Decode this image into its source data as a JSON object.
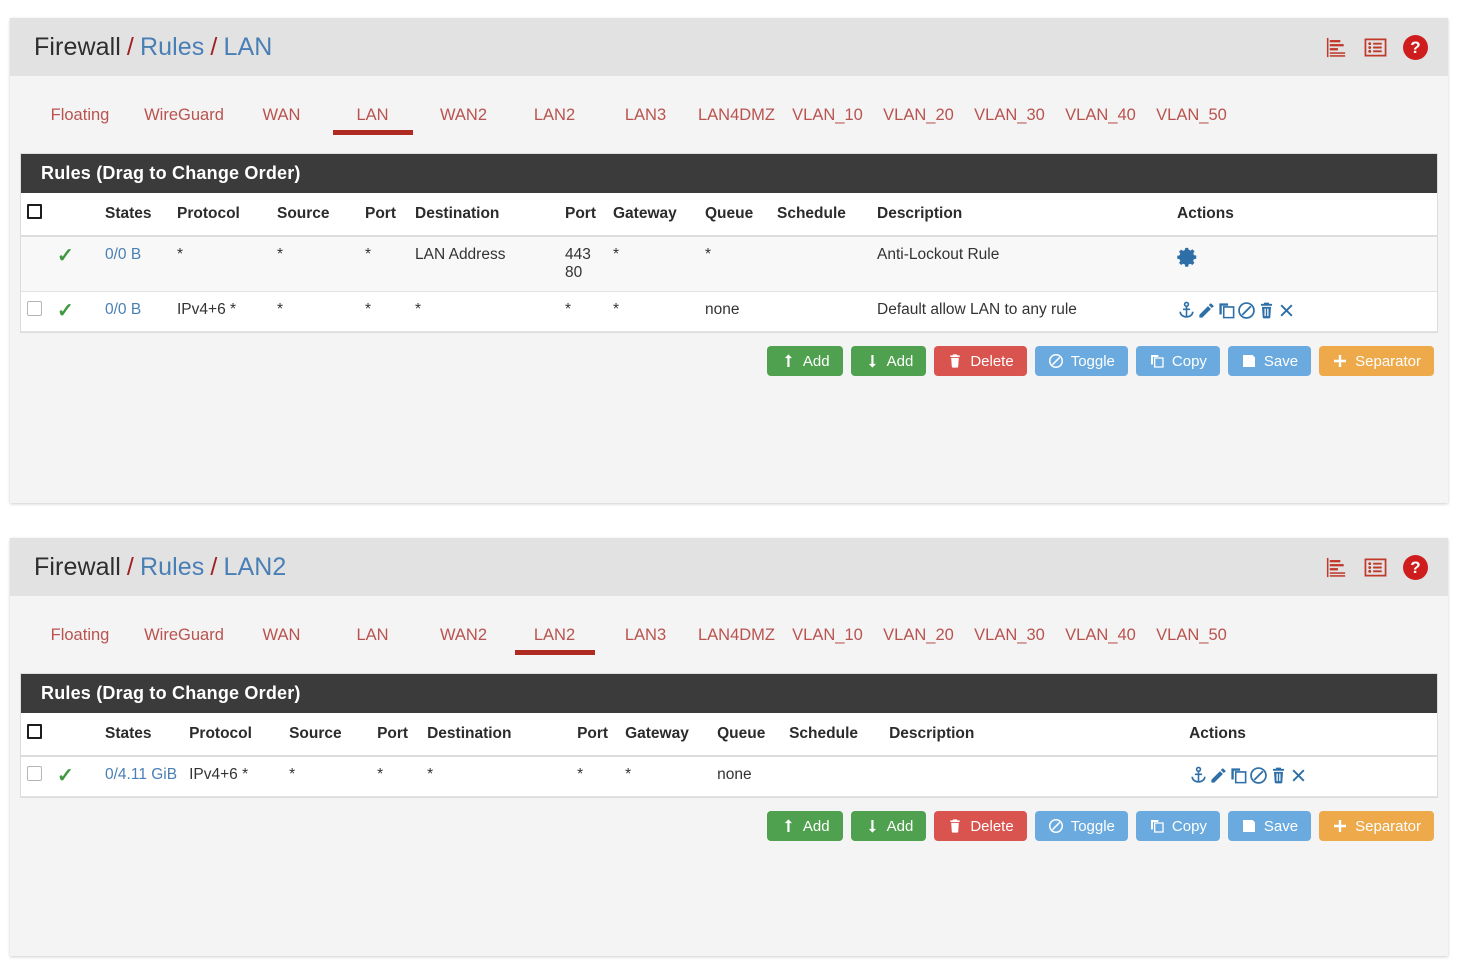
{
  "panels": [
    {
      "breadcrumb": {
        "root": "Firewall",
        "sep": "/",
        "level2": "Rules",
        "level3": "LAN"
      },
      "header_icons": [
        {
          "name": "align-left-chart-icon",
          "label": ""
        },
        {
          "name": "list-icon",
          "label": ""
        },
        {
          "name": "help-icon",
          "label": "?"
        }
      ],
      "tabs": [
        {
          "label": "Floating",
          "active": false
        },
        {
          "label": "WireGuard",
          "active": false
        },
        {
          "label": "WAN",
          "active": false
        },
        {
          "label": "LAN",
          "active": true
        },
        {
          "label": "WAN2",
          "active": false
        },
        {
          "label": "LAN2",
          "active": false
        },
        {
          "label": "LAN3",
          "active": false
        },
        {
          "label": "LAN4DMZ",
          "active": false
        },
        {
          "label": "VLAN_10",
          "active": false
        },
        {
          "label": "VLAN_20",
          "active": false
        },
        {
          "label": "VLAN_30",
          "active": false
        },
        {
          "label": "VLAN_40",
          "active": false
        },
        {
          "label": "VLAN_50",
          "active": false
        }
      ],
      "card_title": "Rules (Drag to Change Order)",
      "columns": [
        "",
        "",
        "States",
        "Protocol",
        "Source",
        "Port",
        "Destination",
        "Port",
        "Gateway",
        "Queue",
        "Schedule",
        "Description",
        "Actions"
      ],
      "rows": [
        {
          "checkbox": false,
          "status": "pass",
          "states": "0/0 B",
          "protocol": "*",
          "source": "*",
          "port": "*",
          "destination": "LAN Address",
          "port2": "443\n80",
          "gateway": "*",
          "queue": "*",
          "schedule": "",
          "description": "Anti-Lockout Rule",
          "actions": [
            "gear-icon"
          ]
        },
        {
          "checkbox": true,
          "status": "pass",
          "states": "0/0 B",
          "protocol": "IPv4+6 *",
          "source": "*",
          "port": "*",
          "destination": "*",
          "port2": "*",
          "gateway": "*",
          "queue": "none",
          "schedule": "",
          "description": "Default allow LAN to any rule",
          "actions": [
            "anchor-icon",
            "edit-pencil-icon",
            "copy-icon",
            "ban-toggle-icon",
            "trash-delete-icon",
            "close-x-icon"
          ]
        }
      ],
      "buttons": [
        {
          "label": "Add",
          "icon": "arrow-up-icon",
          "color": "#4fa14f"
        },
        {
          "label": "Add",
          "icon": "arrow-down-icon",
          "color": "#4fa14f"
        },
        {
          "label": "Delete",
          "icon": "trash-icon",
          "color": "#d9534f"
        },
        {
          "label": "Toggle",
          "icon": "ban-icon",
          "color": "#6aaade"
        },
        {
          "label": "Copy",
          "icon": "copy-icon",
          "color": "#6aaade"
        },
        {
          "label": "Save",
          "icon": "floppy-save-icon",
          "color": "#6aaade"
        },
        {
          "label": "Separator",
          "icon": "plus-icon",
          "color": "#eda94a"
        }
      ]
    },
    {
      "breadcrumb": {
        "root": "Firewall",
        "sep": "/",
        "level2": "Rules",
        "level3": "LAN2"
      },
      "header_icons": [
        {
          "name": "align-left-chart-icon",
          "label": ""
        },
        {
          "name": "list-icon",
          "label": ""
        },
        {
          "name": "help-icon",
          "label": "?"
        }
      ],
      "tabs": [
        {
          "label": "Floating",
          "active": false
        },
        {
          "label": "WireGuard",
          "active": false
        },
        {
          "label": "WAN",
          "active": false
        },
        {
          "label": "LAN",
          "active": false
        },
        {
          "label": "WAN2",
          "active": false
        },
        {
          "label": "LAN2",
          "active": true
        },
        {
          "label": "LAN3",
          "active": false
        },
        {
          "label": "LAN4DMZ",
          "active": false
        },
        {
          "label": "VLAN_10",
          "active": false
        },
        {
          "label": "VLAN_20",
          "active": false
        },
        {
          "label": "VLAN_30",
          "active": false
        },
        {
          "label": "VLAN_40",
          "active": false
        },
        {
          "label": "VLAN_50",
          "active": false
        }
      ],
      "card_title": "Rules (Drag to Change Order)",
      "columns": [
        "",
        "",
        "States",
        "Protocol",
        "Source",
        "Port",
        "Destination",
        "Port",
        "Gateway",
        "Queue",
        "Schedule",
        "Description",
        "Actions"
      ],
      "rows": [
        {
          "checkbox": true,
          "status": "pass",
          "states": "0/4.11 GiB",
          "protocol": "IPv4+6 *",
          "source": "*",
          "port": "*",
          "destination": "*",
          "port2": "*",
          "gateway": "*",
          "queue": "none",
          "schedule": "",
          "description": "",
          "actions": [
            "anchor-icon",
            "edit-pencil-icon",
            "copy-icon",
            "ban-toggle-icon",
            "trash-delete-icon",
            "close-x-icon"
          ]
        }
      ],
      "buttons": [
        {
          "label": "Add",
          "icon": "arrow-up-icon",
          "color": "#4fa14f"
        },
        {
          "label": "Add",
          "icon": "arrow-down-icon",
          "color": "#4fa14f"
        },
        {
          "label": "Delete",
          "icon": "trash-icon",
          "color": "#d9534f"
        },
        {
          "label": "Toggle",
          "icon": "ban-icon",
          "color": "#6aaade"
        },
        {
          "label": "Copy",
          "icon": "copy-icon",
          "color": "#6aaade"
        },
        {
          "label": "Save",
          "icon": "floppy-save-icon",
          "color": "#6aaade"
        },
        {
          "label": "Separator",
          "icon": "plus-icon",
          "color": "#eda94a"
        }
      ]
    }
  ],
  "colors": {
    "tab_red": "#b9534f",
    "active_underline": "#b02a24",
    "link_blue": "#4a7fb5",
    "icon_blue": "#2f6fa8",
    "check_green": "#3f9a3f",
    "card_header_bg": "#3b3b3b",
    "help_red": "#cf1c1c"
  }
}
